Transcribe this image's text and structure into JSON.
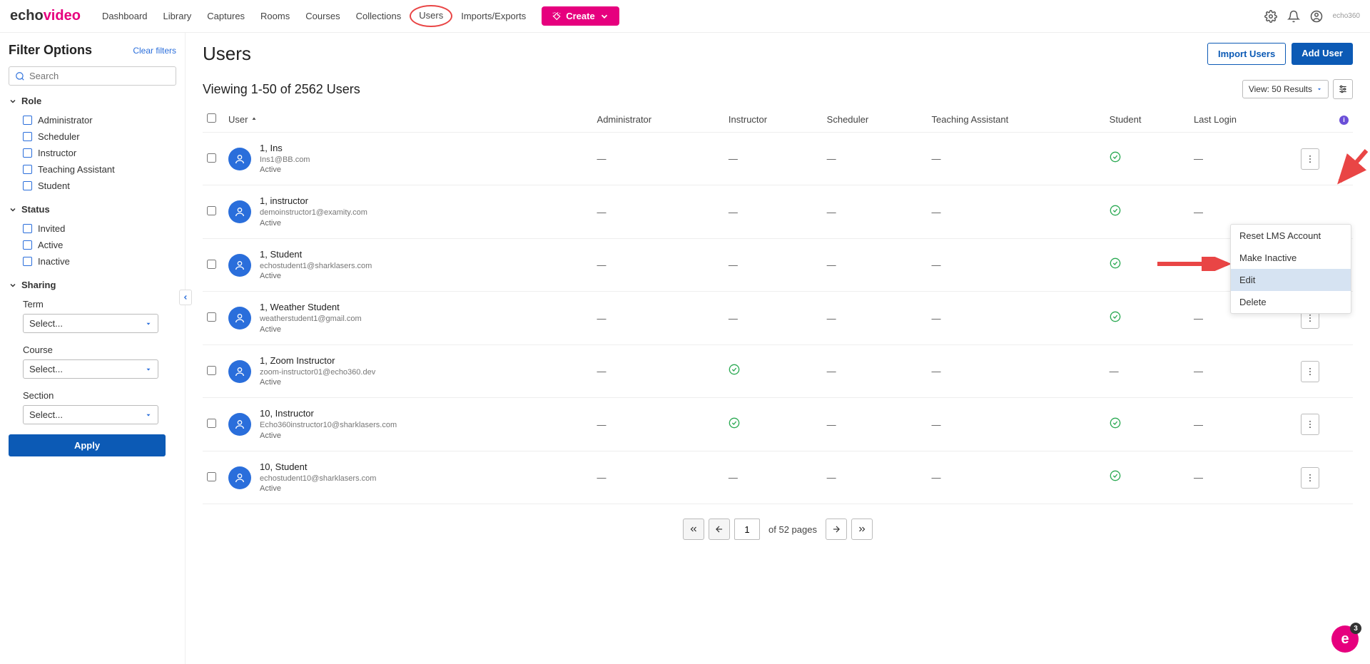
{
  "logo": {
    "part1": "echo",
    "part2": "video"
  },
  "nav": {
    "links": [
      {
        "label": "Dashboard"
      },
      {
        "label": "Library"
      },
      {
        "label": "Captures"
      },
      {
        "label": "Rooms"
      },
      {
        "label": "Courses"
      },
      {
        "label": "Collections"
      },
      {
        "label": "Users",
        "circled": true
      },
      {
        "label": "Imports/Exports"
      }
    ],
    "create_label": "Create",
    "small_logo": "echo360"
  },
  "sidebar": {
    "title": "Filter Options",
    "clear_label": "Clear filters",
    "search_placeholder": "Search",
    "role": {
      "heading": "Role",
      "items": [
        "Administrator",
        "Scheduler",
        "Instructor",
        "Teaching Assistant",
        "Student"
      ]
    },
    "status": {
      "heading": "Status",
      "items": [
        "Invited",
        "Active",
        "Inactive"
      ]
    },
    "sharing": {
      "heading": "Sharing",
      "term_label": "Term",
      "course_label": "Course",
      "section_label": "Section",
      "select_placeholder": "Select..."
    },
    "apply_label": "Apply"
  },
  "page": {
    "title": "Users",
    "import_label": "Import Users",
    "add_label": "Add User",
    "viewing_text": "Viewing 1-50 of 2562 Users",
    "view_select": "View: 50 Results"
  },
  "table": {
    "headers": {
      "user": "User",
      "admin": "Administrator",
      "instructor": "Instructor",
      "scheduler": "Scheduler",
      "ta": "Teaching Assistant",
      "student": "Student",
      "last_login": "Last Login"
    },
    "rows": [
      {
        "name": "1, Ins",
        "email": "Ins1@BB.com",
        "status": "Active",
        "admin": "—",
        "instructor": "—",
        "scheduler": "—",
        "ta": "—",
        "student": "check",
        "last_login": "—"
      },
      {
        "name": "1, instructor",
        "email": "demoinstructor1@examity.com",
        "status": "Active",
        "admin": "—",
        "instructor": "—",
        "scheduler": "—",
        "ta": "—",
        "student": "check",
        "last_login": "—"
      },
      {
        "name": "1, Student",
        "email": "echostudent1@sharklasers.com",
        "status": "Active",
        "admin": "—",
        "instructor": "—",
        "scheduler": "—",
        "ta": "—",
        "student": "check",
        "last_login": "—"
      },
      {
        "name": "1, Weather Student",
        "email": "weatherstudent1@gmail.com",
        "status": "Active",
        "admin": "—",
        "instructor": "—",
        "scheduler": "—",
        "ta": "—",
        "student": "check",
        "last_login": "—"
      },
      {
        "name": "1, Zoom Instructor",
        "email": "zoom-instructor01@echo360.dev",
        "status": "Active",
        "admin": "—",
        "instructor": "check",
        "scheduler": "—",
        "ta": "—",
        "student": "—",
        "last_login": "—"
      },
      {
        "name": "10, Instructor",
        "email": "Echo360instructor10@sharklasers.com",
        "status": "Active",
        "admin": "—",
        "instructor": "check",
        "scheduler": "—",
        "ta": "—",
        "student": "check",
        "last_login": "—"
      },
      {
        "name": "10, Student",
        "email": "echostudent10@sharklasers.com",
        "status": "Active",
        "admin": "—",
        "instructor": "—",
        "scheduler": "—",
        "ta": "—",
        "student": "check",
        "last_login": "—"
      }
    ]
  },
  "context_menu": {
    "items": [
      "Reset LMS Account",
      "Make Inactive",
      "Edit",
      "Delete"
    ],
    "highlighted_index": 2
  },
  "pagination": {
    "current": "1",
    "total_text": "of 52 pages"
  },
  "fab": {
    "symbol": "e",
    "badge": "3"
  }
}
